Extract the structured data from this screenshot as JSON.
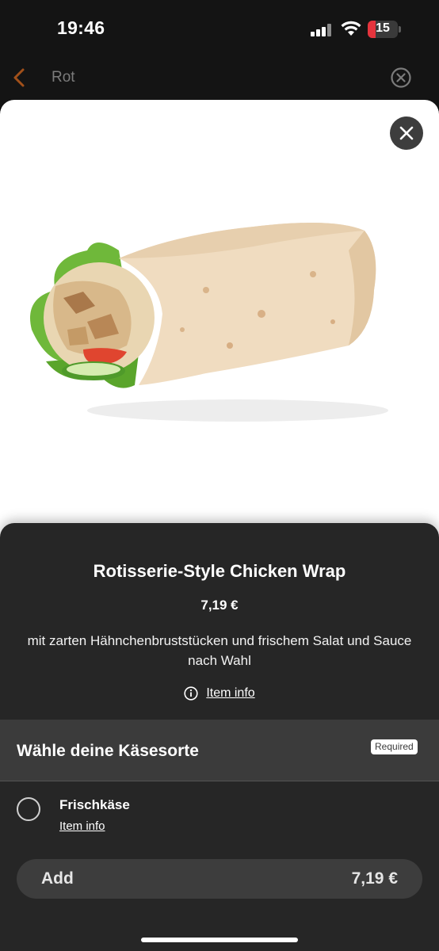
{
  "status_bar": {
    "time": "19:46",
    "battery_level": "15",
    "icons": [
      "signal-icon",
      "wifi-icon",
      "battery-icon"
    ]
  },
  "search_bar": {
    "query": "Rot",
    "icons": [
      "back-chevron-icon",
      "clear-icon"
    ]
  },
  "modal": {
    "close_icon": "close-icon",
    "image": "chicken-wrap-photo"
  },
  "product": {
    "title": "Rotisserie-Style Chicken Wrap",
    "price": "7,19 €",
    "description": "mit zarten Hähnchenbruststücken und frischem Salat und Sauce nach Wahl",
    "item_info_label": "Item info"
  },
  "cheese_section": {
    "title": "Wähle deine Käsesorte",
    "badge": "Required",
    "options": [
      {
        "label": "Frischkäse",
        "info_label": "Item info",
        "selected": false
      }
    ]
  },
  "add_button": {
    "label": "Add",
    "price": "7,19 €"
  },
  "colors": {
    "sheet_background": "#262626",
    "header_background": "#3b3b3b",
    "accent_orange": "#c0611d"
  }
}
